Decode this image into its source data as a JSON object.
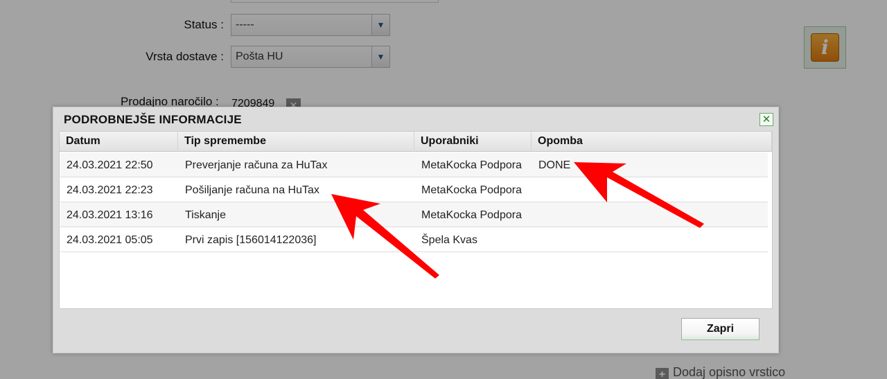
{
  "background_form": {
    "status_label": "Status :",
    "status_value": "-----",
    "delivery_label": "Vrsta dostave :",
    "delivery_value": "Pošta HU",
    "order_label": "Prodajno naročilo :",
    "order_value": "7209849",
    "add_line_label": "Dodaj opisno vrstico"
  },
  "modal": {
    "title": "PODROBNEJŠE INFORMACIJE",
    "columns": [
      "Datum",
      "Tip spremembe",
      "Uporabniki",
      "Opomba"
    ],
    "rows": [
      {
        "date": "24.03.2021 22:50",
        "type": "Preverjanje računa za HuTax",
        "user": "MetaKocka Podpora",
        "note": "DONE"
      },
      {
        "date": "24.03.2021 22:23",
        "type": "Pošiljanje računa na HuTax",
        "user": "MetaKocka Podpora",
        "note": ""
      },
      {
        "date": "24.03.2021 13:16",
        "type": "Tiskanje",
        "user": "MetaKocka Podpora",
        "note": ""
      },
      {
        "date": "24.03.2021 05:05",
        "type": "Prvi zapis [156014122036]",
        "user": "Špela Kvas",
        "note": ""
      }
    ],
    "close_button_label": "Zapri"
  },
  "icons": {
    "info": "info-icon",
    "close": "close-icon",
    "dropdown": "chevron-down-icon",
    "remove": "remove-icon",
    "add": "plus-icon"
  },
  "colors": {
    "accent_red": "#ff0000",
    "info_orange": "#e88a1a",
    "overlay": "#000000"
  }
}
